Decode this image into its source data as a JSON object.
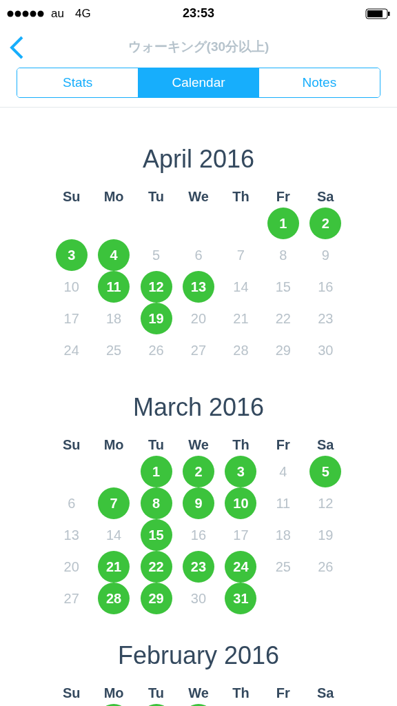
{
  "status_bar": {
    "carrier": "au",
    "network": "4G",
    "time": "23:53"
  },
  "nav": {
    "title": "ウォーキング(30分以上)"
  },
  "tabs": [
    {
      "label": "Stats",
      "selected": false
    },
    {
      "label": "Calendar",
      "selected": true
    },
    {
      "label": "Notes",
      "selected": false
    }
  ],
  "months": [
    {
      "title": "April 2016",
      "weekdays": [
        "Su",
        "Mo",
        "Tu",
        "We",
        "Th",
        "Fr",
        "Sa"
      ],
      "weeks": [
        [
          {
            "kind": "blank"
          },
          {
            "kind": "blank"
          },
          {
            "kind": "blank"
          },
          {
            "kind": "blank"
          },
          {
            "kind": "blank"
          },
          {
            "kind": "day",
            "day": "1",
            "done": true
          },
          {
            "kind": "day",
            "day": "2",
            "done": true
          }
        ],
        [
          {
            "kind": "day",
            "day": "3",
            "done": true
          },
          {
            "kind": "day",
            "day": "4",
            "done": true
          },
          {
            "kind": "day",
            "day": "5",
            "done": false
          },
          {
            "kind": "day",
            "day": "6",
            "done": false
          },
          {
            "kind": "day",
            "day": "7",
            "done": false
          },
          {
            "kind": "day",
            "day": "8",
            "done": false
          },
          {
            "kind": "day",
            "day": "9",
            "done": false
          }
        ],
        [
          {
            "kind": "day",
            "day": "10",
            "done": false
          },
          {
            "kind": "day",
            "day": "11",
            "done": true
          },
          {
            "kind": "day",
            "day": "12",
            "done": true
          },
          {
            "kind": "day",
            "day": "13",
            "done": true
          },
          {
            "kind": "day",
            "day": "14",
            "done": false
          },
          {
            "kind": "day",
            "day": "15",
            "done": false
          },
          {
            "kind": "day",
            "day": "16",
            "done": false
          }
        ],
        [
          {
            "kind": "day",
            "day": "17",
            "done": false
          },
          {
            "kind": "day",
            "day": "18",
            "done": false
          },
          {
            "kind": "day",
            "day": "19",
            "done": true
          },
          {
            "kind": "day",
            "day": "20",
            "done": false
          },
          {
            "kind": "day",
            "day": "21",
            "done": false
          },
          {
            "kind": "day",
            "day": "22",
            "done": false
          },
          {
            "kind": "day",
            "day": "23",
            "done": false
          }
        ],
        [
          {
            "kind": "day",
            "day": "24",
            "done": false
          },
          {
            "kind": "day",
            "day": "25",
            "done": false
          },
          {
            "kind": "day",
            "day": "26",
            "done": false
          },
          {
            "kind": "day",
            "day": "27",
            "done": false
          },
          {
            "kind": "day",
            "day": "28",
            "done": false
          },
          {
            "kind": "day",
            "day": "29",
            "done": false
          },
          {
            "kind": "day",
            "day": "30",
            "done": false
          }
        ]
      ]
    },
    {
      "title": "March 2016",
      "weekdays": [
        "Su",
        "Mo",
        "Tu",
        "We",
        "Th",
        "Fr",
        "Sa"
      ],
      "weeks": [
        [
          {
            "kind": "blank"
          },
          {
            "kind": "blank"
          },
          {
            "kind": "day",
            "day": "1",
            "done": true
          },
          {
            "kind": "day",
            "day": "2",
            "done": true
          },
          {
            "kind": "day",
            "day": "3",
            "done": true
          },
          {
            "kind": "day",
            "day": "4",
            "done": false
          },
          {
            "kind": "day",
            "day": "5",
            "done": true
          }
        ],
        [
          {
            "kind": "day",
            "day": "6",
            "done": false
          },
          {
            "kind": "day",
            "day": "7",
            "done": true
          },
          {
            "kind": "day",
            "day": "8",
            "done": true
          },
          {
            "kind": "day",
            "day": "9",
            "done": true
          },
          {
            "kind": "day",
            "day": "10",
            "done": true
          },
          {
            "kind": "day",
            "day": "11",
            "done": false
          },
          {
            "kind": "day",
            "day": "12",
            "done": false
          }
        ],
        [
          {
            "kind": "day",
            "day": "13",
            "done": false
          },
          {
            "kind": "day",
            "day": "14",
            "done": false
          },
          {
            "kind": "day",
            "day": "15",
            "done": true
          },
          {
            "kind": "day",
            "day": "16",
            "done": false
          },
          {
            "kind": "day",
            "day": "17",
            "done": false
          },
          {
            "kind": "day",
            "day": "18",
            "done": false
          },
          {
            "kind": "day",
            "day": "19",
            "done": false
          }
        ],
        [
          {
            "kind": "day",
            "day": "20",
            "done": false
          },
          {
            "kind": "day",
            "day": "21",
            "done": true
          },
          {
            "kind": "day",
            "day": "22",
            "done": true
          },
          {
            "kind": "day",
            "day": "23",
            "done": true
          },
          {
            "kind": "day",
            "day": "24",
            "done": true
          },
          {
            "kind": "day",
            "day": "25",
            "done": false
          },
          {
            "kind": "day",
            "day": "26",
            "done": false
          }
        ],
        [
          {
            "kind": "day",
            "day": "27",
            "done": false
          },
          {
            "kind": "day",
            "day": "28",
            "done": true
          },
          {
            "kind": "day",
            "day": "29",
            "done": true
          },
          {
            "kind": "day",
            "day": "30",
            "done": false
          },
          {
            "kind": "day",
            "day": "31",
            "done": true
          }
        ]
      ]
    },
    {
      "title": "February 2016",
      "weekdays": [
        "Su",
        "Mo",
        "Tu",
        "We",
        "Th",
        "Fr",
        "Sa"
      ],
      "weeks": [
        [
          {
            "kind": "blank"
          },
          {
            "kind": "day",
            "done": true
          },
          {
            "kind": "day",
            "done": true
          },
          {
            "kind": "day",
            "done": true
          }
        ]
      ]
    }
  ]
}
